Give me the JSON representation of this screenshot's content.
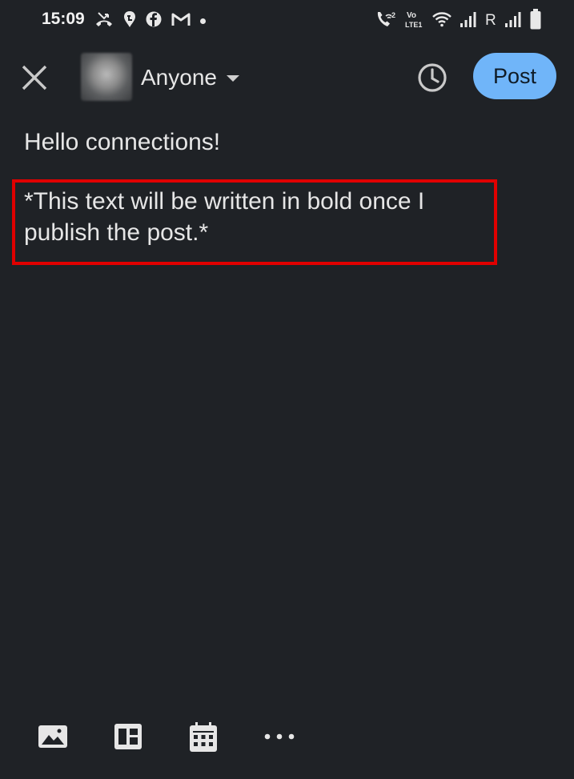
{
  "status_bar": {
    "time": "15:09",
    "carrier_letter": "R",
    "left_icons": [
      "missed-call-icon",
      "swiggy-icon",
      "facebook-icon",
      "gmail-icon",
      "notification-dot-icon"
    ],
    "right_icons": [
      "wifi-call-icon",
      "volte-icon",
      "wifi-icon",
      "signal-icon",
      "signal-icon",
      "battery-icon"
    ]
  },
  "header": {
    "visibility_label": "Anyone",
    "post_label": "Post",
    "post_color": "#70b5f9"
  },
  "editor": {
    "line1": "Hello connections!",
    "line2": "*This text will be written in bold once I publish the post.*",
    "highlight_color": "#e00000"
  },
  "toolbar": {
    "icons": [
      "image-icon",
      "document-icon",
      "calendar-icon",
      "more-icon"
    ]
  },
  "colors": {
    "background": "#1f2226",
    "text": "#e6e6e6"
  }
}
